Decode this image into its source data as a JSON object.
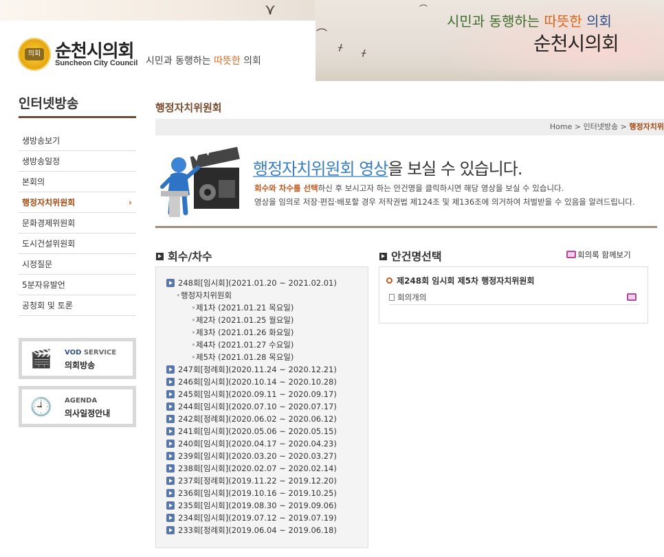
{
  "header": {
    "logo_kr": "순천시의회",
    "logo_en": "Suncheon City Council",
    "emblem_label": "의회",
    "slogan_small_pre": "시민과 동행하는 ",
    "slogan_small_hl": "따뜻한",
    "slogan_small_post": " 의회",
    "slogan_big_pre": "시민과 동행하는 ",
    "slogan_big_hl": "따뜻한",
    "slogan_big_post": " 의회",
    "council_big": "순천시의회"
  },
  "sidebar": {
    "title": "인터넷방송",
    "items": [
      {
        "label": "생방송보기"
      },
      {
        "label": "생방송일정"
      },
      {
        "label": "본회의"
      },
      {
        "label": "행정자치위원회",
        "active": true
      },
      {
        "label": "문화경제위원회"
      },
      {
        "label": "도시건설위원회"
      },
      {
        "label": "시정질문"
      },
      {
        "label": "5분자유발언"
      },
      {
        "label": "공청회 및 토론"
      }
    ],
    "active_arrow": "›",
    "banner_vod": {
      "line1_a": "VOD",
      "line1_b": " SERVICE",
      "line2": "의회방송"
    },
    "banner_agenda": {
      "line1": "AGENDA",
      "line2": "의사일정안내"
    }
  },
  "content": {
    "page_title": "행정자치위원회",
    "breadcrumb": {
      "home": "Home",
      "sep": ">",
      "level1": "인터넷방송",
      "current": "행정자치위"
    },
    "intro": {
      "headline_hl": "행정자치위원회 영상",
      "headline_post": "을 보실 수 있습니다.",
      "line1_hl": "회수와 차수를 선택",
      "line1_post": "하신 후 보시고자 하는 안건명을 클릭하시면 해당 영상을 보실 수 있습니다.",
      "line2": "영상을 임의로 저장·편집·배포할 경우 저작권법 제124조 및 제136조에 의거하여 처벌받을 수 있음을 알려드립니다."
    },
    "session_section_title": "회수/차수",
    "agenda_section_title": "안건명선택",
    "minutes_link": "회의록 함께보기",
    "expanded_session": "248회[임시회](2021.01.20 ~ 2021.02.01)",
    "committee": "행정자치위원회",
    "meetings": [
      "제1차 (2021.01.21 목요일)",
      "제2차 (2021.01.25 월요일)",
      "제3차 (2021.01.26 화요일)",
      "제4차 (2021.01.27 수요일)",
      "제5차 (2021.01.28 목요일)"
    ],
    "sessions": [
      "247회[정례회](2020.11.24 ~ 2020.12.21)",
      "246회[임시회](2020.10.14 ~ 2020.10.28)",
      "245회[임시회](2020.09.11 ~ 2020.09.17)",
      "244회[임시회](2020.07.10 ~ 2020.07.17)",
      "242회[정례회](2020.06.02 ~ 2020.06.12)",
      "241회[임시회](2020.05.06 ~ 2020.05.15)",
      "240회[임시회](2020.04.17 ~ 2020.04.23)",
      "239회[임시회](2020.03.20 ~ 2020.03.27)",
      "238회[임시회](2020.02.07 ~ 2020.02.14)",
      "237회[정례회](2019.11.22 ~ 2019.12.20)",
      "236회[임시회](2019.10.16 ~ 2019.10.25)",
      "235회[임시회](2019.08.30 ~ 2019.09.06)",
      "234회[임시회](2019.07.12 ~ 2019.07.19)",
      "233회[정례회](2019.06.04 ~ 2019.06.18)"
    ],
    "agenda": {
      "heading": "제248회 임시회 제5차 행정자치위원회",
      "item": "회의개의"
    }
  },
  "colors": {
    "accent_brown": "#7b4a2a",
    "active_orange": "#a34a13",
    "headline_blue": "#3a7fc0",
    "session_icon_blue": "#5877a8"
  }
}
